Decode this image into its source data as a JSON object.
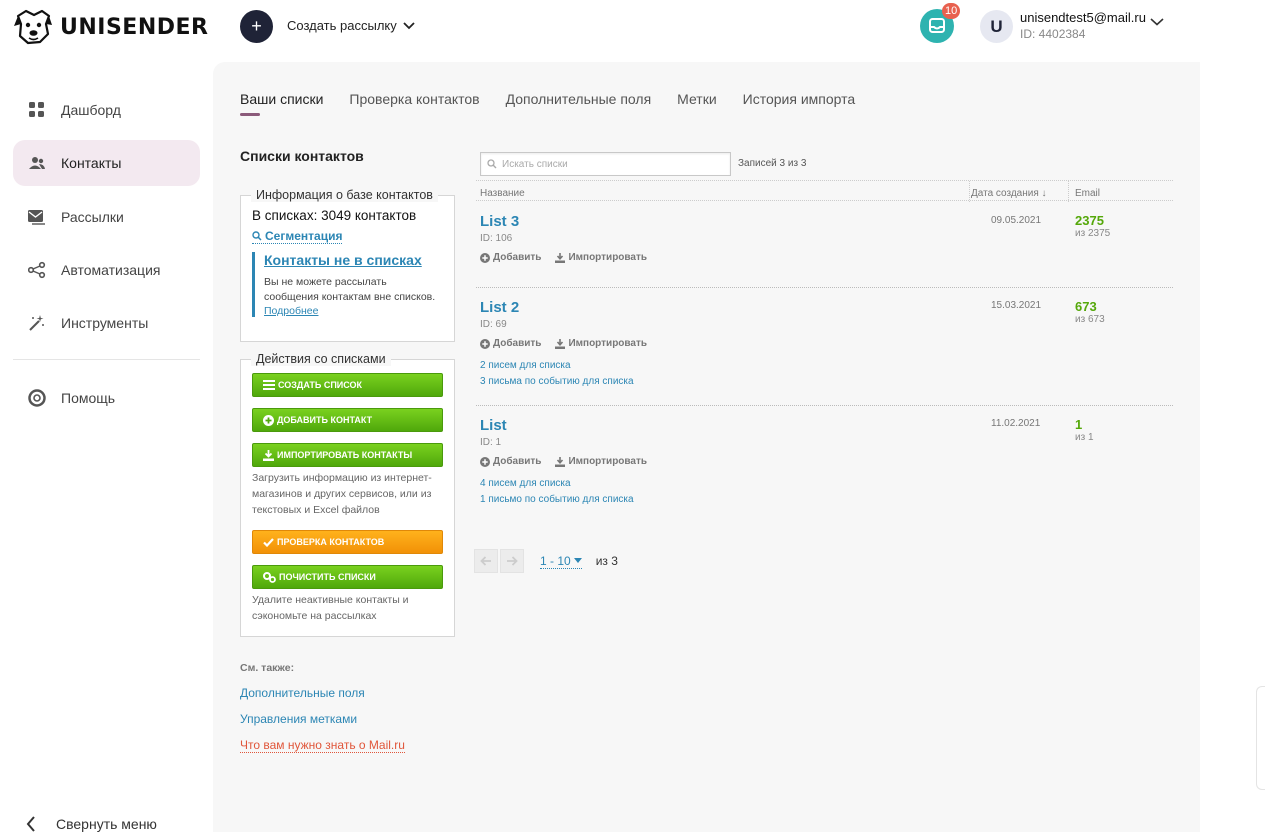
{
  "brand": {
    "name": "UNISENDER"
  },
  "header": {
    "create_label": "Создать рассылку",
    "notif_count": "10",
    "avatar_letter": "U",
    "user_email": "unisendtest5@mail.ru",
    "user_id": "ID: 4402384"
  },
  "sidebar": {
    "items": [
      {
        "label": "Дашборд",
        "icon": "dashboard-icon"
      },
      {
        "label": "Контакты",
        "icon": "contacts-icon",
        "active": true
      },
      {
        "label": "Рассылки",
        "icon": "mail-icon"
      },
      {
        "label": "Автоматизация",
        "icon": "automation-icon"
      },
      {
        "label": "Инструменты",
        "icon": "magic-wand-icon"
      },
      {
        "label": "Помощь",
        "icon": "help-icon"
      }
    ],
    "collapse_label": "Свернуть меню"
  },
  "tabs": [
    {
      "label": "Ваши списки",
      "active": true
    },
    {
      "label": "Проверка контактов"
    },
    {
      "label": "Дополнительные поля"
    },
    {
      "label": "Метки"
    },
    {
      "label": "История импорта"
    }
  ],
  "section_title": "Списки контактов",
  "info_box": {
    "legend": "Информация о базе контактов",
    "count_text": "В списках: 3049 контактов",
    "segmentation": "Сегментация",
    "notlist_title": "Контакты не в списках",
    "notlist_text": "Вы не можете рассылать сообщения контактам вне списков.",
    "notlist_more": "Подробнее"
  },
  "actions_box": {
    "legend": "Действия со списками",
    "create_list": "создать список",
    "add_contact": "добавить контакт",
    "import_contacts": "импортировать контакты",
    "import_note": "Загрузить информацию из интернет-магазинов и других сервисов, или из текстовых и Excel файлов",
    "check_contacts": "проверка контактов",
    "clean_lists": "почистить списки",
    "clean_note": "Удалите неактивные контакты и сэкономьте на рассылках"
  },
  "see_also": {
    "title": "См. также:",
    "links": [
      "Дополнительные поля",
      "Управления метками",
      "Что вам нужно знать о Mail.ru"
    ]
  },
  "table": {
    "search_placeholder": "Искать списки",
    "records": "Записей 3 из 3",
    "col_name": "Название",
    "col_date": "Дата создания ↓",
    "col_email": "Email",
    "add_label": "Добавить",
    "import_label": "Импортировать",
    "rows": [
      {
        "name": "List 3",
        "id": "ID: 106",
        "date": "09.05.2021",
        "count": "2375",
        "of": "из 2375",
        "links": []
      },
      {
        "name": "List 2",
        "id": "ID: 69",
        "date": "15.03.2021",
        "count": "673",
        "of": "из 673",
        "links": [
          "2 писем для списка",
          "3 письма по событию для списка"
        ]
      },
      {
        "name": "List",
        "id": "ID: 1",
        "date": "11.02.2021",
        "count": "1",
        "of": "из 1",
        "links": [
          "4 писем для списка",
          "1 письмо по событию для списка"
        ]
      }
    ]
  },
  "pager": {
    "range": "1 - 10",
    "of": "из 3"
  },
  "colors": {
    "accent": "#2c86b4",
    "green": "#55a80a",
    "active_nav": "#f3e9f0",
    "tab_underline": "#8b5a7a"
  }
}
